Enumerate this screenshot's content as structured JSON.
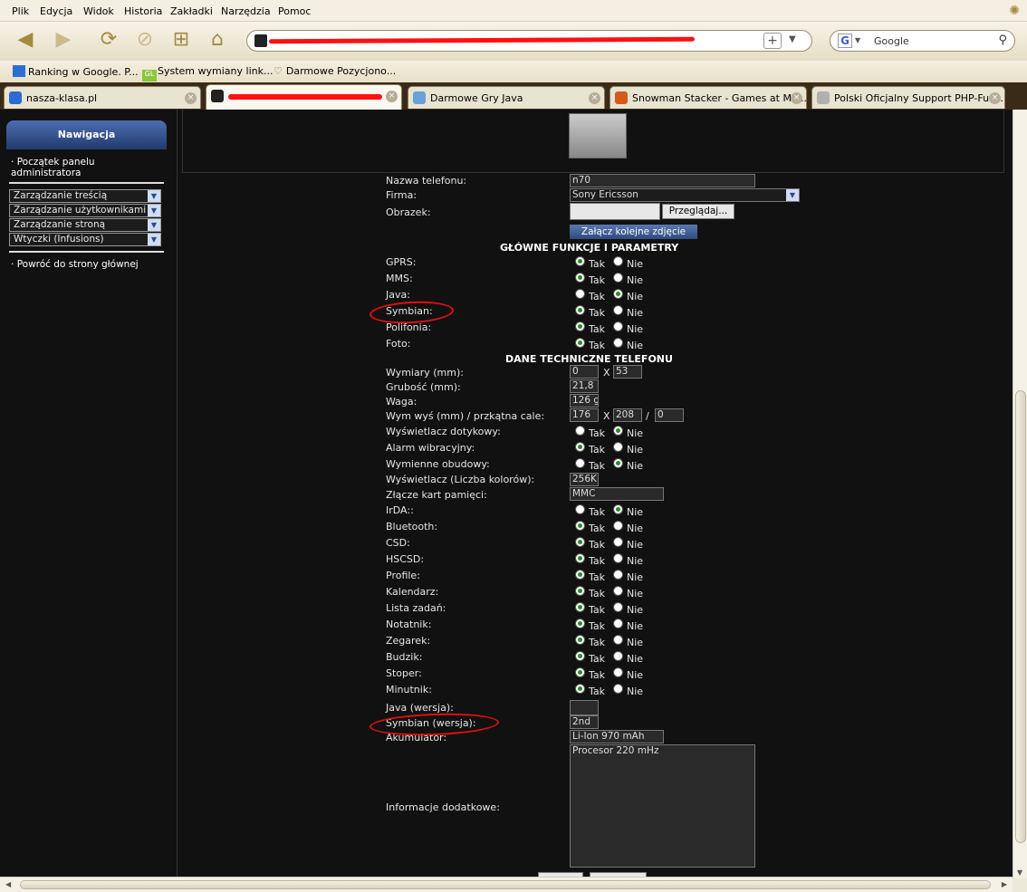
{
  "menu": [
    "Plik",
    "Edycja",
    "Widok",
    "Historia",
    "Zakładki",
    "Narzędzia",
    "Pomoc"
  ],
  "search_placeholder": "Google",
  "bookmarks": [
    "Ranking w Google. P...",
    "System wymiany link...",
    "Darmowe Pozycjono..."
  ],
  "tabs": [
    "nasza-klasa.pl",
    "",
    "Darmowe Gry Java",
    "Snowman Stacker - Games at Min...",
    "Polski Oficjalny Support PHP-Fusi..."
  ],
  "sidebar": {
    "title": "Nawigacja",
    "start": "Początek panelu",
    "start2": "administratora",
    "menus": [
      "Zarządzanie treścią",
      "Zarządzanie użytkownikami",
      "Zarządzanie stroną",
      "Wtyczki (Infusions)"
    ],
    "back": "Powróć do strony głównej"
  },
  "form": {
    "name_label": "Nazwa telefonu:",
    "name_val": "n70",
    "firm_label": "Firma:",
    "firm_val": "Sony Ericsson",
    "img_label": "Obrazek:",
    "browse": "Przeglądaj...",
    "attach": "Załącz kolejne zdjęcie",
    "sec1": "GŁÓWNE FUNKCJE I PARAMETRY",
    "sec2": "DANE TECHNICZNE TELEFONU",
    "tak": "Tak",
    "nie": "Nie",
    "rows1": [
      {
        "label": "GPRS:",
        "val": "tak"
      },
      {
        "label": "MMS:",
        "val": "tak"
      },
      {
        "label": "Java:",
        "val": "nie"
      },
      {
        "label": "Symbian:",
        "val": "tak"
      },
      {
        "label": "Polifonia:",
        "val": "tak"
      },
      {
        "label": "Foto:",
        "val": "tak"
      }
    ],
    "dims_label": "Wymiary (mm):",
    "dims_a": "0",
    "dims_x": "X",
    "dims_b": "53",
    "thick_label": "Grubość (mm):",
    "thick_val": "21,8",
    "weight_label": "Waga:",
    "weight_val": "126 g",
    "screen_label": "Wym wyś (mm) / przkątna cale:",
    "screen_a": "176",
    "screen_x": "X",
    "screen_b": "208",
    "screen_slash": "/",
    "screen_c": "0",
    "touch_label": "Wyświetlacz dotykowy:",
    "touch_val": "nie",
    "vibra_label": "Alarm wibracyjny:",
    "vibra_val": "tak",
    "covers_label": "Wymienne obudowy:",
    "covers_val": "nie",
    "colors_label": "Wyświetlacz (Liczba kolorów):",
    "colors_val": "256K",
    "card_label": "Złącze kart pamięci:",
    "card_val": "MMC",
    "rows2": [
      {
        "label": "IrDA::",
        "val": "nie"
      },
      {
        "label": "Bluetooth:",
        "val": "tak"
      },
      {
        "label": "CSD:",
        "val": "tak"
      },
      {
        "label": "HSCSD:",
        "val": "tak"
      },
      {
        "label": "Profile:",
        "val": "tak"
      },
      {
        "label": "Kalendarz:",
        "val": "tak"
      },
      {
        "label": "Lista zadań:",
        "val": "tak"
      },
      {
        "label": "Notatnik:",
        "val": "tak"
      },
      {
        "label": "Zegarek:",
        "val": "tak"
      },
      {
        "label": "Budzik:",
        "val": "tak"
      },
      {
        "label": "Stoper:",
        "val": "tak"
      },
      {
        "label": "Minutnik:",
        "val": "tak"
      }
    ],
    "java_ver_label": "Java (wersja):",
    "java_ver_val": "",
    "symb_ver_label": "Symbian (wersja):",
    "symb_ver_val": "2nd",
    "battery_label": "Akumulator:",
    "battery_val": "Li-Ion 970 mAh",
    "info_label": "Informacje dodatkowe:",
    "info_val": "Procesor 220 mHz"
  },
  "colors": {
    "accent": "#ff1010",
    "panel": "#111111"
  }
}
